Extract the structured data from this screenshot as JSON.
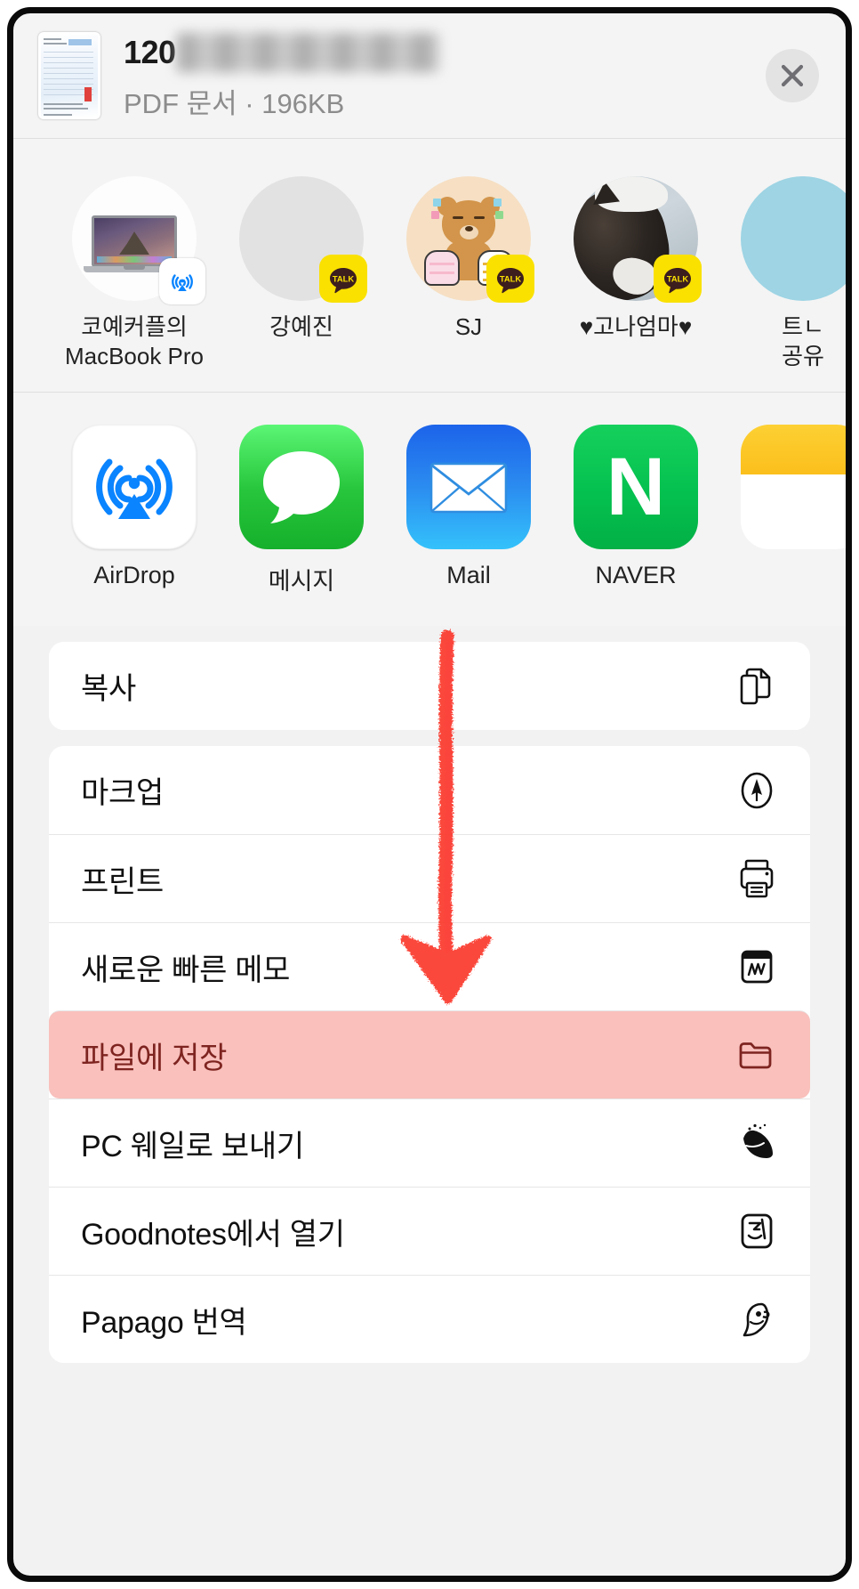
{
  "sheet": {
    "type": "ios-share-sheet",
    "accent_highlight_color": "#f9c0bc",
    "annotation_color": "#fb3a2e"
  },
  "header": {
    "title": "120",
    "title_redacted": true,
    "subtitle": "PDF 문서 · 196KB",
    "close_label": "close-icon",
    "thumbnail_name": "pdf-document-thumbnail"
  },
  "contacts": [
    {
      "label": "코예커플의\nMacBook Pro",
      "line1": "코예커플의",
      "line2": "MacBook Pro",
      "badge": "airdrop-badge",
      "avatar": "macbook-pro-avatar"
    },
    {
      "label": "강예진",
      "line1": "강예진",
      "line2": "",
      "badge": "kakaotalk-badge",
      "avatar": "blank-gray-avatar"
    },
    {
      "label": "SJ",
      "line1": "SJ",
      "line2": "",
      "badge": "kakaotalk-badge",
      "avatar": "ryan-character-avatar"
    },
    {
      "label": "♥고나엄마♥",
      "line1": "♥고나엄마♥",
      "line2": "",
      "badge": "kakaotalk-badge",
      "avatar": "cat-photo-avatar"
    },
    {
      "label": "트ㄴ\n공유",
      "line1": "트ㄴ",
      "line2": "공유",
      "badge": "",
      "avatar": "blue-circle-avatar"
    }
  ],
  "apps": [
    {
      "label": "AirDrop",
      "icon": "airdrop-icon"
    },
    {
      "label": "메시지",
      "icon": "messages-icon"
    },
    {
      "label": "Mail",
      "icon": "mail-icon"
    },
    {
      "label": "NAVER",
      "icon": "naver-icon",
      "glyph": "N"
    },
    {
      "label": "",
      "icon": "notes-icon"
    }
  ],
  "action_groups": [
    {
      "rows": [
        {
          "label": "복사",
          "icon": "copy-icon",
          "highlighted": false
        }
      ]
    },
    {
      "rows": [
        {
          "label": "마크업",
          "icon": "markup-pen-icon",
          "highlighted": false
        },
        {
          "label": "프린트",
          "icon": "printer-icon",
          "highlighted": false
        },
        {
          "label": "새로운 빠른 메모",
          "icon": "quick-note-icon",
          "highlighted": false
        },
        {
          "label": "파일에 저장",
          "icon": "folder-icon",
          "highlighted": true
        },
        {
          "label": "PC 웨일로 보내기",
          "icon": "whale-browser-icon",
          "highlighted": false
        },
        {
          "label": "Goodnotes에서 열기",
          "icon": "goodnotes-icon",
          "highlighted": false
        },
        {
          "label": "Papago 번역",
          "icon": "papago-parrot-icon",
          "highlighted": false
        }
      ]
    }
  ],
  "annotation": {
    "type": "hand-drawn-down-arrow",
    "color": "#fb3a2e",
    "points_to": "파일에 저장"
  }
}
